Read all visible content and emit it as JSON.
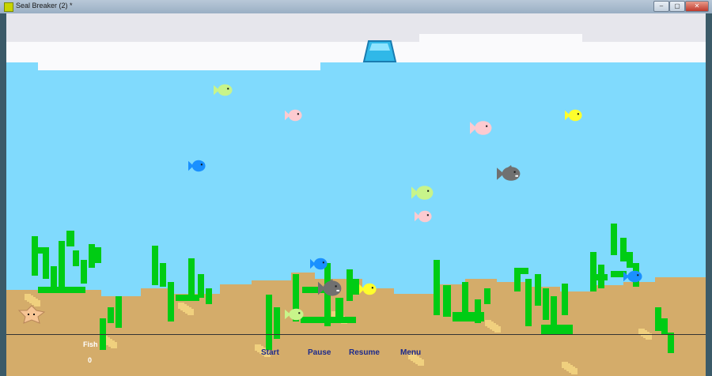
{
  "window": {
    "title": "Seal Breaker (2) *",
    "controls": [
      "–",
      "▢",
      "✕"
    ]
  },
  "hud": {
    "fish_label": "Fish",
    "fish_count": "0"
  },
  "buttons": {
    "start": "Start",
    "pause": "Pause",
    "resume": "Resume",
    "menu": "Menu"
  },
  "colors": {
    "water": "#80dafd",
    "sky": "#e6e6ec",
    "cloud": "#fafafc",
    "sand": "#d4ac6a",
    "sand_dots": "#f0d07e",
    "seaweed": "#00cc14",
    "paddle": "#30b8e8",
    "fish_green": "#c8f48a",
    "fish_pink": "#fccad0",
    "fish_blue": "#1a90ff",
    "fish_yellow": "#fefe2c",
    "shark": "#707070",
    "starfish": "#f6c494",
    "buttons_text": "#1c2a8c"
  },
  "fish": [
    {
      "type": "fish_green"
    },
    {
      "type": "fish_pink"
    },
    {
      "type": "fish_yellow"
    },
    {
      "type": "fish_pink"
    },
    {
      "type": "fish_blue"
    },
    {
      "type": "shark"
    },
    {
      "type": "fish_green"
    },
    {
      "type": "fish_pink"
    },
    {
      "type": "fish_blue"
    },
    {
      "type": "fish_blue"
    },
    {
      "type": "shark"
    },
    {
      "type": "fish_yellow"
    },
    {
      "type": "fish_green"
    }
  ]
}
